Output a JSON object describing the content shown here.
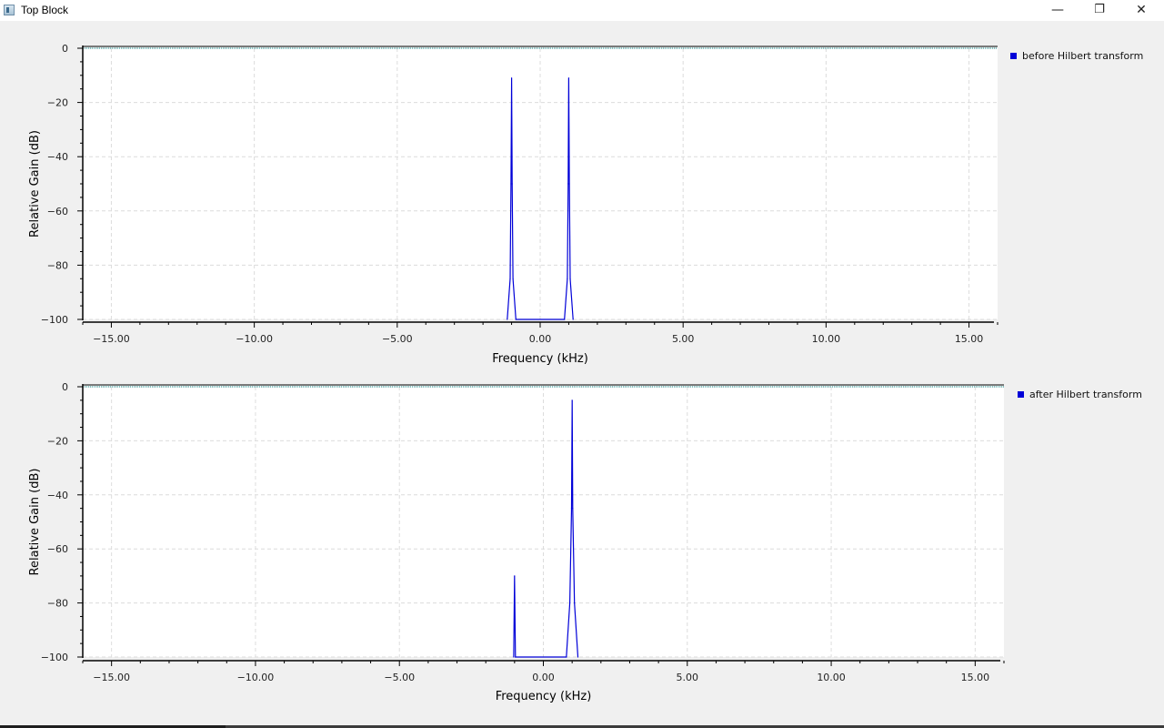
{
  "window": {
    "title": "Top Block",
    "minimize_glyph": "—",
    "maximize_glyph": "❐",
    "close_glyph": "✕",
    "icon": "app-window-icon"
  },
  "colors": {
    "trace": "#0000d8",
    "reference_line": "#008080",
    "grid": "#dcdcdc",
    "plot_background": "#ffffff",
    "window_background": "#f0f0f0"
  },
  "chart_data": [
    {
      "type": "line",
      "legend": "before Hilbert transform",
      "xlabel": "Frequency (kHz)",
      "ylabel": "Relative Gain (dB)",
      "xlim": [
        -16.0,
        16.0
      ],
      "ylim": [
        -100,
        0
      ],
      "xticks": [
        -15,
        -10,
        -5,
        0,
        5,
        10,
        15
      ],
      "xtick_labels": [
        "−15.00",
        "−10.00",
        "−5.00",
        "0.00",
        "5.00",
        "10.00",
        "15.00"
      ],
      "yticks": [
        0,
        -20,
        -40,
        -60,
        -80,
        -100
      ],
      "ytick_labels": [
        "0",
        "−20",
        "−40",
        "−60",
        "−80",
        "−100"
      ],
      "reference_level_db": 0,
      "series": [
        {
          "x": [
            -1.15,
            -1.05,
            -1.02,
            -1.0,
            -0.98,
            -0.95,
            -0.85,
            0.85,
            0.95,
            0.98,
            1.0,
            1.02,
            1.05,
            1.15
          ],
          "y": [
            -100,
            -85,
            -50,
            -11,
            -50,
            -85,
            -100,
            -100,
            -85,
            -50,
            -11,
            -50,
            -85,
            -100
          ]
        }
      ]
    },
    {
      "type": "line",
      "legend": "after Hilbert transform",
      "xlabel": "Frequency (kHz)",
      "ylabel": "Relative Gain (dB)",
      "xlim": [
        -16.0,
        16.0
      ],
      "ylim": [
        -100,
        0
      ],
      "xticks": [
        -15,
        -10,
        -5,
        0,
        5,
        10,
        15
      ],
      "xtick_labels": [
        "−15.00",
        "−10.00",
        "−5.00",
        "0.00",
        "5.00",
        "10.00",
        "15.00"
      ],
      "yticks": [
        0,
        -20,
        -40,
        -60,
        -80,
        -100
      ],
      "ytick_labels": [
        "0",
        "−20",
        "−40",
        "−60",
        "−80",
        "−100"
      ],
      "reference_level_db": 0,
      "series": [
        {
          "x": [
            -1.03,
            -1.0,
            -0.97,
            0.8,
            0.92,
            0.98,
            1.0,
            1.02,
            1.08,
            1.2
          ],
          "y": [
            -100,
            -70,
            -100,
            -100,
            -80,
            -45,
            -5,
            -45,
            -80,
            -100
          ]
        }
      ]
    }
  ]
}
